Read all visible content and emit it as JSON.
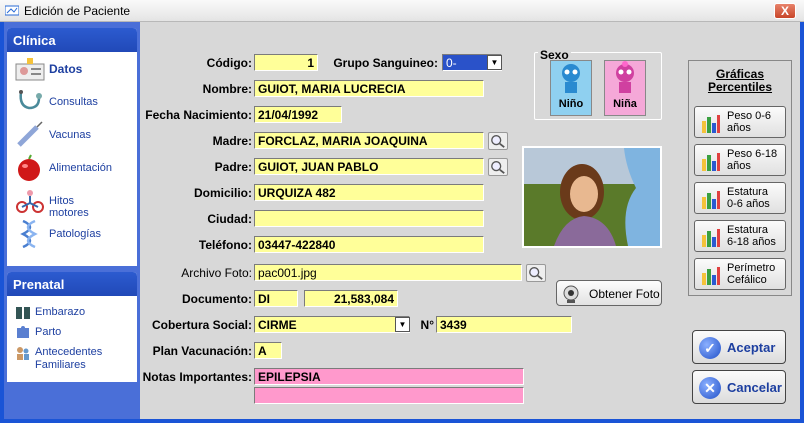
{
  "window": {
    "title": "Edición de Paciente",
    "close_glyph": "X"
  },
  "sidebar": {
    "clinica": {
      "header": "Clínica",
      "items": [
        {
          "label": "Datos",
          "icon": "id-card-icon",
          "selected": true
        },
        {
          "label": "Consultas",
          "icon": "stethoscope-icon"
        },
        {
          "label": "Vacunas",
          "icon": "syringe-icon"
        },
        {
          "label": "Alimentación",
          "icon": "apple-icon"
        },
        {
          "label": "Hitos motores",
          "icon": "tricycle-icon"
        },
        {
          "label": "Patologías",
          "icon": "dna-icon"
        }
      ]
    },
    "prenatal": {
      "header": "Prenatal",
      "items": [
        {
          "label": "Embarazo",
          "icon": "book-icon"
        },
        {
          "label": "Parto",
          "icon": "puzzle-icon"
        },
        {
          "label": "Antecedentes Familiares",
          "icon": "family-icon"
        }
      ]
    }
  },
  "form": {
    "codigo": {
      "label": "Código:",
      "value": "1"
    },
    "grupo_sanguineo": {
      "label": "Grupo Sanguineo:",
      "value": "0-"
    },
    "nombre": {
      "label": "Nombre:",
      "value": "GUIOT, MARIA LUCRECIA"
    },
    "fecha_nacimiento": {
      "label": "Fecha Nacimiento:",
      "value": "21/04/1992"
    },
    "madre": {
      "label": "Madre:",
      "value": "FORCLAZ, MARIA JOAQUINA"
    },
    "padre": {
      "label": "Padre:",
      "value": "GUIOT, JUAN PABLO"
    },
    "domicilio": {
      "label": "Domicilio:",
      "value": "URQUIZA 482"
    },
    "ciudad": {
      "label": "Ciudad:",
      "value": ""
    },
    "telefono": {
      "label": "Teléfono:",
      "value": "03447-422840"
    },
    "archivo_foto": {
      "label": "Archivo Foto:",
      "value": "pac001.jpg"
    },
    "documento": {
      "label": "Documento:",
      "tipo": "DI",
      "numero": "21,583,084"
    },
    "cobertura_social": {
      "label": "Cobertura Social:",
      "value": "CIRME",
      "numero_label": "N°",
      "numero": "3439"
    },
    "plan_vacunacion": {
      "label": "Plan Vacunación:",
      "value": "A"
    },
    "notas": {
      "label": "Notas Importantes:",
      "line1": "EPILEPSIA",
      "line2": ""
    }
  },
  "sexo": {
    "title": "Sexo",
    "nino": "Niño",
    "nina": "Niña",
    "selected": "nina"
  },
  "buttons": {
    "obtener_foto": "Obtener Foto",
    "aceptar": "Aceptar",
    "cancelar": "Cancelar"
  },
  "graficas": {
    "title_line1": "Gráficas",
    "title_line2": "Percentiles",
    "items": [
      {
        "line1": "Peso 0-6",
        "line2": "años"
      },
      {
        "line1": "Peso 6-18",
        "line2": "años"
      },
      {
        "line1": "Estatura",
        "line2": "0-6 años"
      },
      {
        "line1": "Estatura",
        "line2": "6-18 años"
      },
      {
        "line1": "Perímetro",
        "line2": "Cefálico"
      }
    ]
  },
  "colors": {
    "field_yellow": "#ffff99",
    "field_pink": "#ff99cc",
    "sidebar_blue": "#2c5bd0"
  }
}
